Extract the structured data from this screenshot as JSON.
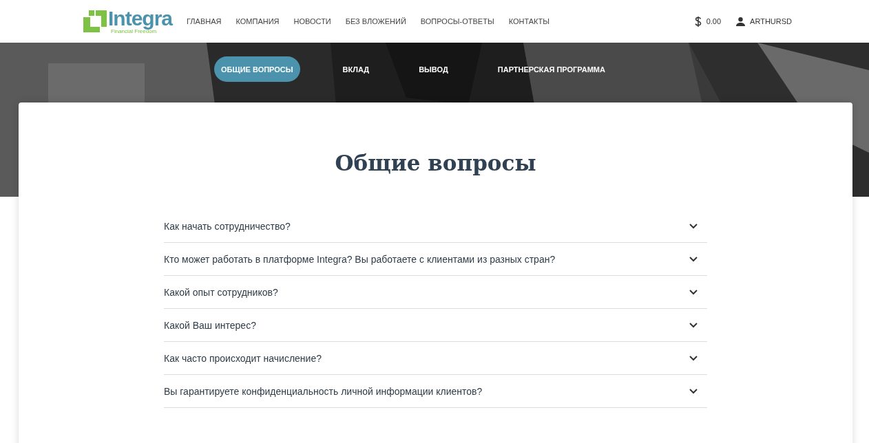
{
  "header": {
    "logo": {
      "name": "Integra",
      "tagline": "Financial Freedom"
    },
    "nav": [
      {
        "label": "ГЛАВНАЯ"
      },
      {
        "label": "КОМПАНИЯ"
      },
      {
        "label": "НОВОСТИ"
      },
      {
        "label": "БЕЗ ВЛОЖЕНИЙ"
      },
      {
        "label": "ВОПРОСЫ-ОТВЕТЫ"
      },
      {
        "label": "КОНТАКТЫ"
      }
    ],
    "balance": "0.00",
    "user": "ARTHURSD"
  },
  "tabs": [
    {
      "label": "ОБЩИЕ ВОПРОСЫ",
      "selected": true
    },
    {
      "label": "ВКЛАД",
      "selected": false
    },
    {
      "label": "ВЫВОД",
      "selected": false
    },
    {
      "label": "ПАРТНЕРСКАЯ ПРОГРАММА",
      "selected": false
    }
  ],
  "section": {
    "title": "Общие вопросы",
    "questions": [
      {
        "text": "Как начать сотрудничество?",
        "expanded": false
      },
      {
        "text": "Кто может работать в платформе Integra? Вы работаете с клиентами из разных стран?",
        "expanded": false
      },
      {
        "text": "Какой опыт сотрудников?",
        "expanded": false
      },
      {
        "text": "Какой Ваш интерес?",
        "expanded": false
      },
      {
        "text": "Как часто происходит начисление?",
        "expanded": false
      },
      {
        "text": "Вы гарантируете конфиденциальность личной информации клиентов?",
        "expanded": false
      }
    ]
  }
}
